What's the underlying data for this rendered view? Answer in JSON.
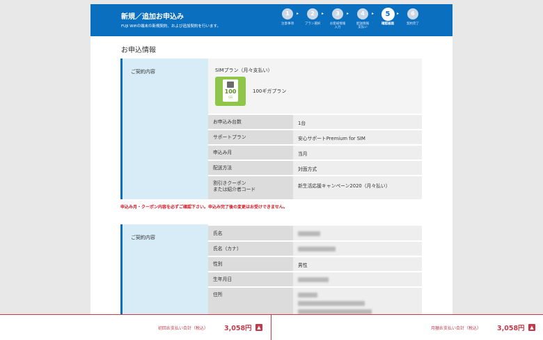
{
  "header": {
    "title": "新規／追加お申込み",
    "subtitle": "FUJI Wifiの端末の新規契約、および追加契約を行います。"
  },
  "steps": [
    {
      "num": "1",
      "label": "注意事項"
    },
    {
      "num": "2",
      "label": "プラン選択"
    },
    {
      "num": "3",
      "label": "お客様情報\n入力"
    },
    {
      "num": "4",
      "label": "配送情報\n支払い"
    },
    {
      "num": "5",
      "label": "確認画面"
    },
    {
      "num": "6",
      "label": "契約完了"
    }
  ],
  "active_step": 5,
  "section_title": "お申込情報",
  "contract": {
    "label": "ご契約内容",
    "plan_heading": "SIMプラン（月々支払い）",
    "sim_icon_number": "100",
    "sim_icon_unit": "GB",
    "plan_name": "100ギガプラン",
    "rows": [
      {
        "key": "お申込み台数",
        "value": "1台"
      },
      {
        "key": "サポートプラン",
        "value": "安心サポートPremium for SIM"
      },
      {
        "key": "申込み月",
        "value": "当月"
      },
      {
        "key": "配送方法",
        "value": "対面方式"
      },
      {
        "key": "割引きクーポン\nまたは紹介者コード",
        "value": "新生活応援キャンペーン2020（月々払い）"
      }
    ]
  },
  "warning": "申込み月・クーポン内容を必ずご確認下さい。申込み完了後の変更はお受けできません。",
  "customer": {
    "label": "ご契約内容",
    "rows": [
      {
        "key": "氏名",
        "value": ""
      },
      {
        "key": "氏名（カナ）",
        "value": ""
      },
      {
        "key": "性別",
        "value": "男性"
      },
      {
        "key": "生年月日",
        "value": ""
      },
      {
        "key": "住所",
        "value": ""
      }
    ]
  },
  "footer": {
    "initial_label": "初回お支払い合計（税込）",
    "initial_amount": "3,058円",
    "monthly_label": "月額お支払い合計（税込）",
    "monthly_amount": "3,058円",
    "expand_symbol": "▲"
  },
  "colors": {
    "brand": "#0b6fc0",
    "accent": "#c23a4a",
    "warning": "#d0131f",
    "sim_green": "#8fc64a"
  }
}
